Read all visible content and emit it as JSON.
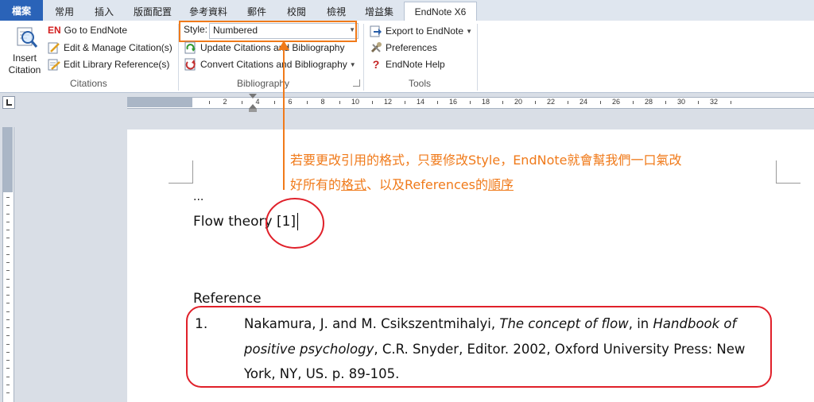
{
  "tabs": [
    "檔案",
    "常用",
    "插入",
    "版面配置",
    "參考資料",
    "郵件",
    "校閱",
    "檢視",
    "增益集",
    "EndNote X6"
  ],
  "ribbon": {
    "insert_citation": [
      "Insert",
      "Citation"
    ],
    "go_to_endnote_badge": "EN",
    "go_to_endnote": "Go to EndNote",
    "edit_manage": "Edit & Manage Citation(s)",
    "edit_library": "Edit Library Reference(s)",
    "citations_group": "Citations",
    "style_label": "Style:",
    "style_value": "Numbered",
    "update_citations": "Update Citations and Bibliography",
    "convert_citations": "Convert Citations and Bibliography",
    "bibliography_group": "Bibliography",
    "export_to_endnote": "Export to EndNote",
    "preferences": "Preferences",
    "endnote_help": "EndNote Help",
    "tools_group": "Tools"
  },
  "ruler": {
    "marks": [
      "6",
      "4",
      "2",
      "2",
      "4",
      "6",
      "8",
      "10",
      "12",
      "14",
      "16",
      "18",
      "20",
      "22",
      "24",
      "26",
      "28",
      "30",
      "32"
    ]
  },
  "annotation": {
    "line1": "若要更改引用的格式，只要修改Style，EndNote就會幫我們一口氣改",
    "line2_a": "好所有的",
    "line2_b": "格式",
    "line2_c": "、以及References的",
    "line2_d": "順序"
  },
  "document": {
    "ellipsis": "...",
    "flow_theory": "Flow theory [1]",
    "reference_heading": "Reference",
    "ref_number": "1.",
    "ref_line1_a": "Nakamura, J. and M. Csikszentmihalyi, ",
    "ref_line1_b": "The concept of flow",
    "ref_line1_c": ", in ",
    "ref_line1_d": "Handbook of",
    "ref_line2_a": "positive psychology",
    "ref_line2_b": ",  C.R. Snyder, Editor. 2002, Oxford University Press: New",
    "ref_line3": "York, NY, US. p. 89-105."
  },
  "colors": {
    "annotation": "#f07a1a",
    "highlight_circle": "#e0202a",
    "file_tab": "#2a63b8"
  }
}
